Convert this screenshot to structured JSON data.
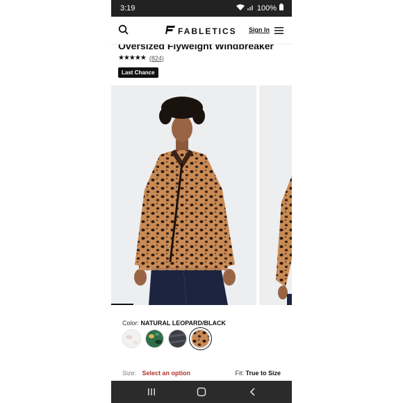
{
  "status_bar": {
    "time": "3:19",
    "battery": "100%"
  },
  "header": {
    "brand": "FABLETICS",
    "sign_in_label": "Sign In"
  },
  "product": {
    "title": "Oversized Flyweight Windbreaker",
    "rating_count": "(824)",
    "badge": "Last Chance"
  },
  "color": {
    "label": "Color:",
    "selected": "NATURAL LEOPARD/BLACK",
    "swatches": [
      "white-swatch",
      "green-print-swatch",
      "dark-grey-swatch",
      "leopard-swatch"
    ]
  },
  "size": {
    "label": "Size:",
    "placeholder": "Select an option"
  },
  "fit": {
    "label": "Fit:",
    "value": "True to Size"
  },
  "colors": {
    "accent": "#b3352c",
    "ink": "#111111",
    "status_bar": "#222222",
    "nav_bar": "#2b2b2b"
  }
}
